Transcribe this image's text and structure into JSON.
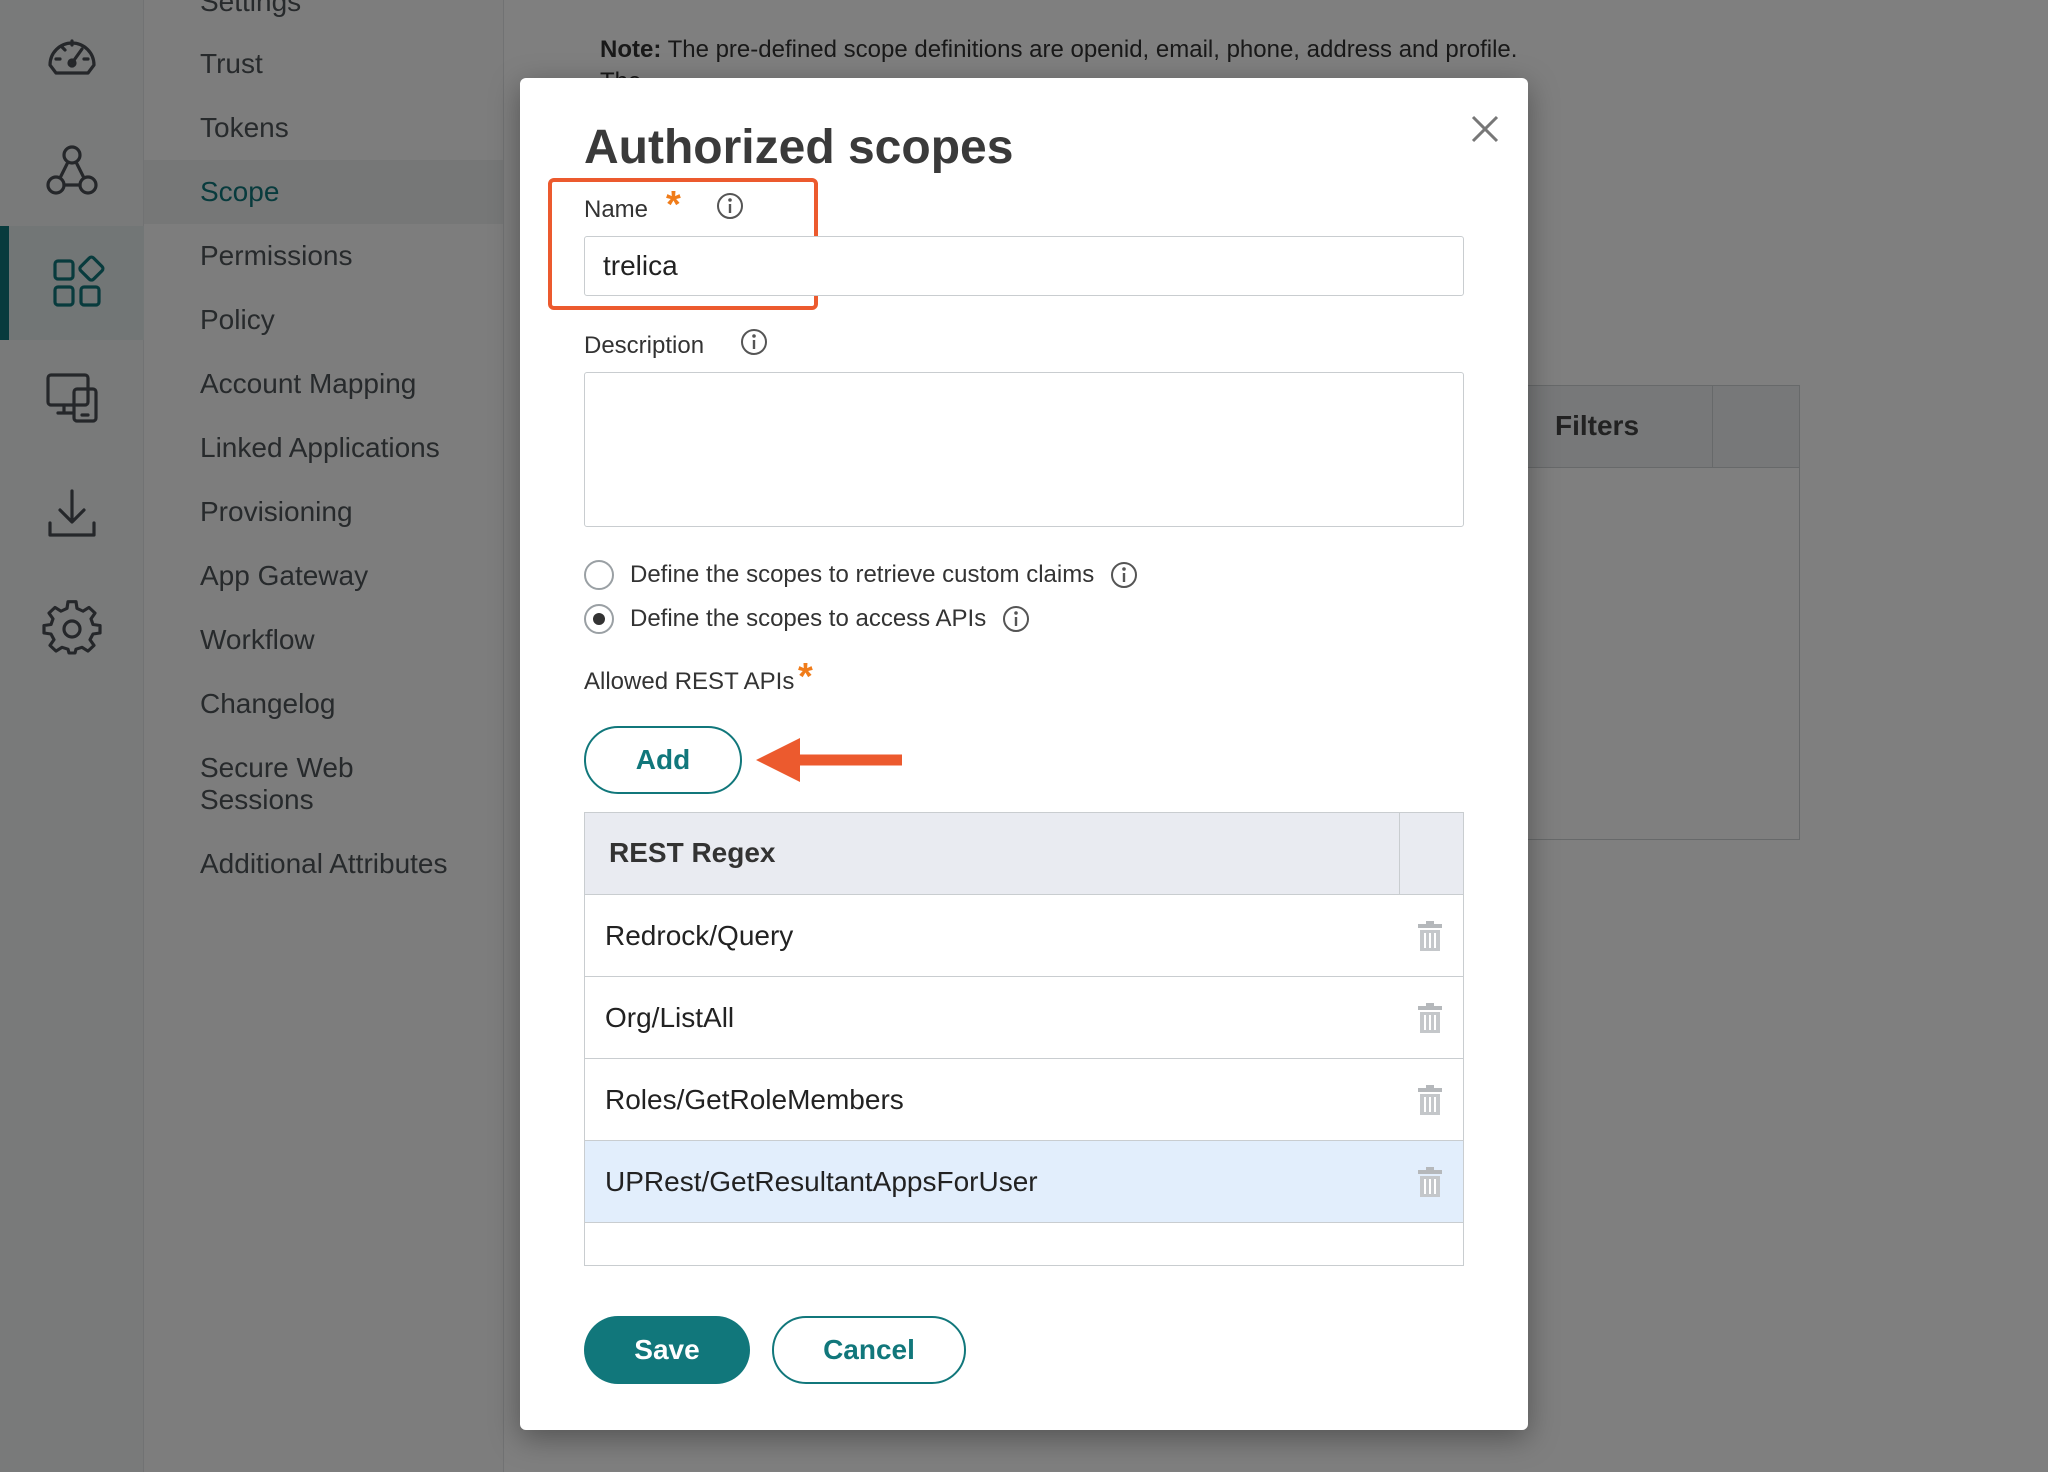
{
  "rail": {
    "items": [
      {
        "icon": "dashboard-icon"
      },
      {
        "icon": "network-icon"
      },
      {
        "icon": "apps-icon",
        "active": true
      },
      {
        "icon": "devices-icon"
      },
      {
        "icon": "download-icon"
      },
      {
        "icon": "settings-icon"
      }
    ]
  },
  "subnav": {
    "items": [
      {
        "label": "Settings"
      },
      {
        "label": "Trust"
      },
      {
        "label": "Tokens"
      },
      {
        "label": "Scope",
        "active": true
      },
      {
        "label": "Permissions"
      },
      {
        "label": "Policy"
      },
      {
        "label": "Account Mapping"
      },
      {
        "label": "Linked Applications"
      },
      {
        "label": "Provisioning"
      },
      {
        "label": "App Gateway"
      },
      {
        "label": "Workflow"
      },
      {
        "label": "Changelog"
      },
      {
        "label": "Secure Web Sessions"
      },
      {
        "label": "Additional Attributes"
      }
    ]
  },
  "background": {
    "note_label": "Note:",
    "note_text": " The pre-defined scope definitions are openid, email, phone, address and profile.",
    "note_line2": "The                          ",
    "table_header": "Filters"
  },
  "modal": {
    "title": "Authorized scopes",
    "name_label": "Name",
    "name_value": "trelica",
    "required_mark": "*",
    "description_label": "Description",
    "radio_options": [
      {
        "label": "Define the scopes to retrieve custom claims",
        "checked": false
      },
      {
        "label": "Define the scopes to access APIs",
        "checked": true
      }
    ],
    "allowed_label": "Allowed REST APIs",
    "add_label": "Add",
    "table_header": "REST Regex",
    "rows": [
      {
        "value": "Redrock/Query"
      },
      {
        "value": "Org/ListAll"
      },
      {
        "value": "Roles/GetRoleMembers"
      },
      {
        "value": "UPRest/GetResultantAppsForUser",
        "selected": true
      }
    ],
    "save_label": "Save",
    "cancel_label": "Cancel"
  },
  "colors": {
    "accent": "#11777b",
    "required": "#f07c1a",
    "annotation": "#ec5a2e",
    "selected_row": "#e2eefc"
  }
}
